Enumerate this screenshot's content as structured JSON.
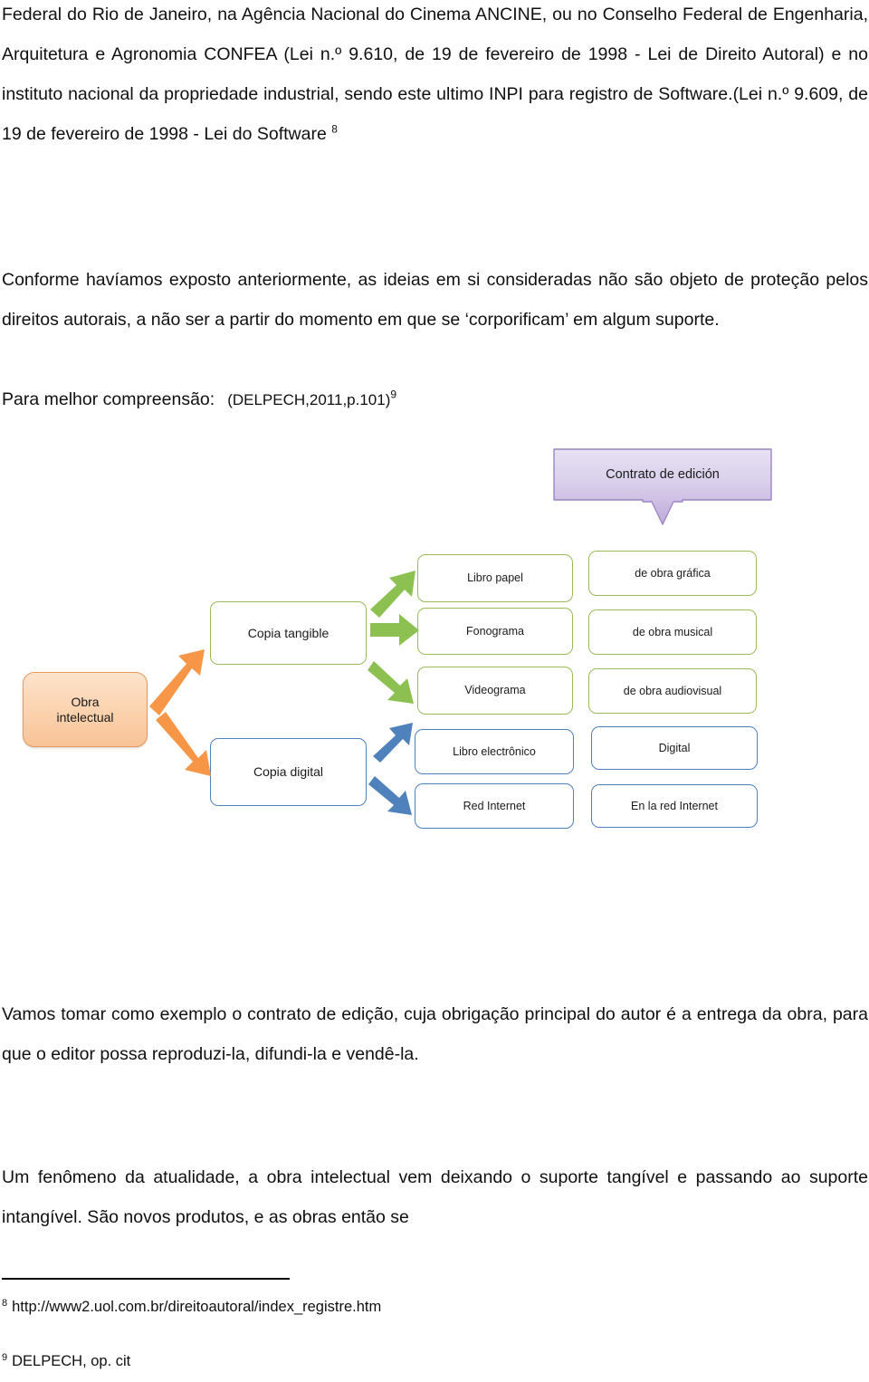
{
  "document": {
    "paragraphs": {
      "registro": "Federal do Rio de Janeiro, na Agência Nacional do Cinema ANCINE, ou no Conselho Federal de Engenharia, Arquitetura e Agronomia CONFEA (Lei n.º 9.610, de 19 de fevereiro de 1998 - Lei de Direito Autoral) e no instituto nacional da propriedade industrial, sendo este ultimo INPI para registro de Software.(Lei n.º 9.609, de 19 de fevereiro de 1998 - Lei do Software ",
      "registro_sup": "8",
      "conforme": "Conforme havíamos exposto anteriormente, as ideias em si consideradas não são objeto de proteção pelos direitos autorais, a não ser a partir do momento em que se ‘corporificam’ em algum suporte.",
      "compreensao_lead": "Para melhor compreensão:",
      "compreensao_cite": "(DELPECH,2011,p.101)",
      "compreensao_sup": "9",
      "vamos": "Vamos tomar como exemplo o contrato de edição, cuja obrigação principal do autor é a entrega da obra, para que o editor possa reproduzi-la, difundi-la e vendê-la.",
      "fenomeno": "Um fenômeno da atualidade, a obra intelectual vem deixando o suporte tangível e passando ao suporte intangível. São novos produtos, e as obras então se"
    },
    "footnotes": [
      {
        "marker": "8",
        "text": "http://www2.uol.com.br/direitoautoral/index_registre.htm"
      },
      {
        "marker": "9",
        "text": "DELPECH, op. cit"
      }
    ]
  },
  "diagram": {
    "callout": {
      "label": "Contrato de edición",
      "fill_top": "#e3dbf0",
      "fill_bottom": "#c4b2de",
      "stroke": "#9a86c4"
    },
    "colors": {
      "green": "#9bbb59",
      "blue": "#4f81bd",
      "orange": "#e8995b",
      "orange_fill": "#fbd0ab",
      "green_arrow": "#8cc152",
      "blue_arrow": "#4f81bd",
      "orange_arrow": "#f79646"
    },
    "root": {
      "line1": "Obra",
      "line2": "intelectual"
    },
    "branches": [
      {
        "label": "Copia tangible",
        "color": "green"
      },
      {
        "label": "Copia digital",
        "color": "blue"
      }
    ],
    "supports": [
      {
        "label": "Libro papel",
        "color": "green"
      },
      {
        "label": "Fonograma",
        "color": "green"
      },
      {
        "label": "Videograma",
        "color": "green"
      },
      {
        "label": "Libro electrônico",
        "color": "blue"
      },
      {
        "label": "Red Internet",
        "color": "blue"
      }
    ],
    "works": [
      {
        "label": "de obra gráfica",
        "color": "green"
      },
      {
        "label": "de obra musical",
        "color": "green"
      },
      {
        "label": "de obra audiovisual",
        "color": "green"
      },
      {
        "label": "Digital",
        "color": "blue"
      },
      {
        "label": "En la red Internet",
        "color": "blue"
      }
    ]
  }
}
